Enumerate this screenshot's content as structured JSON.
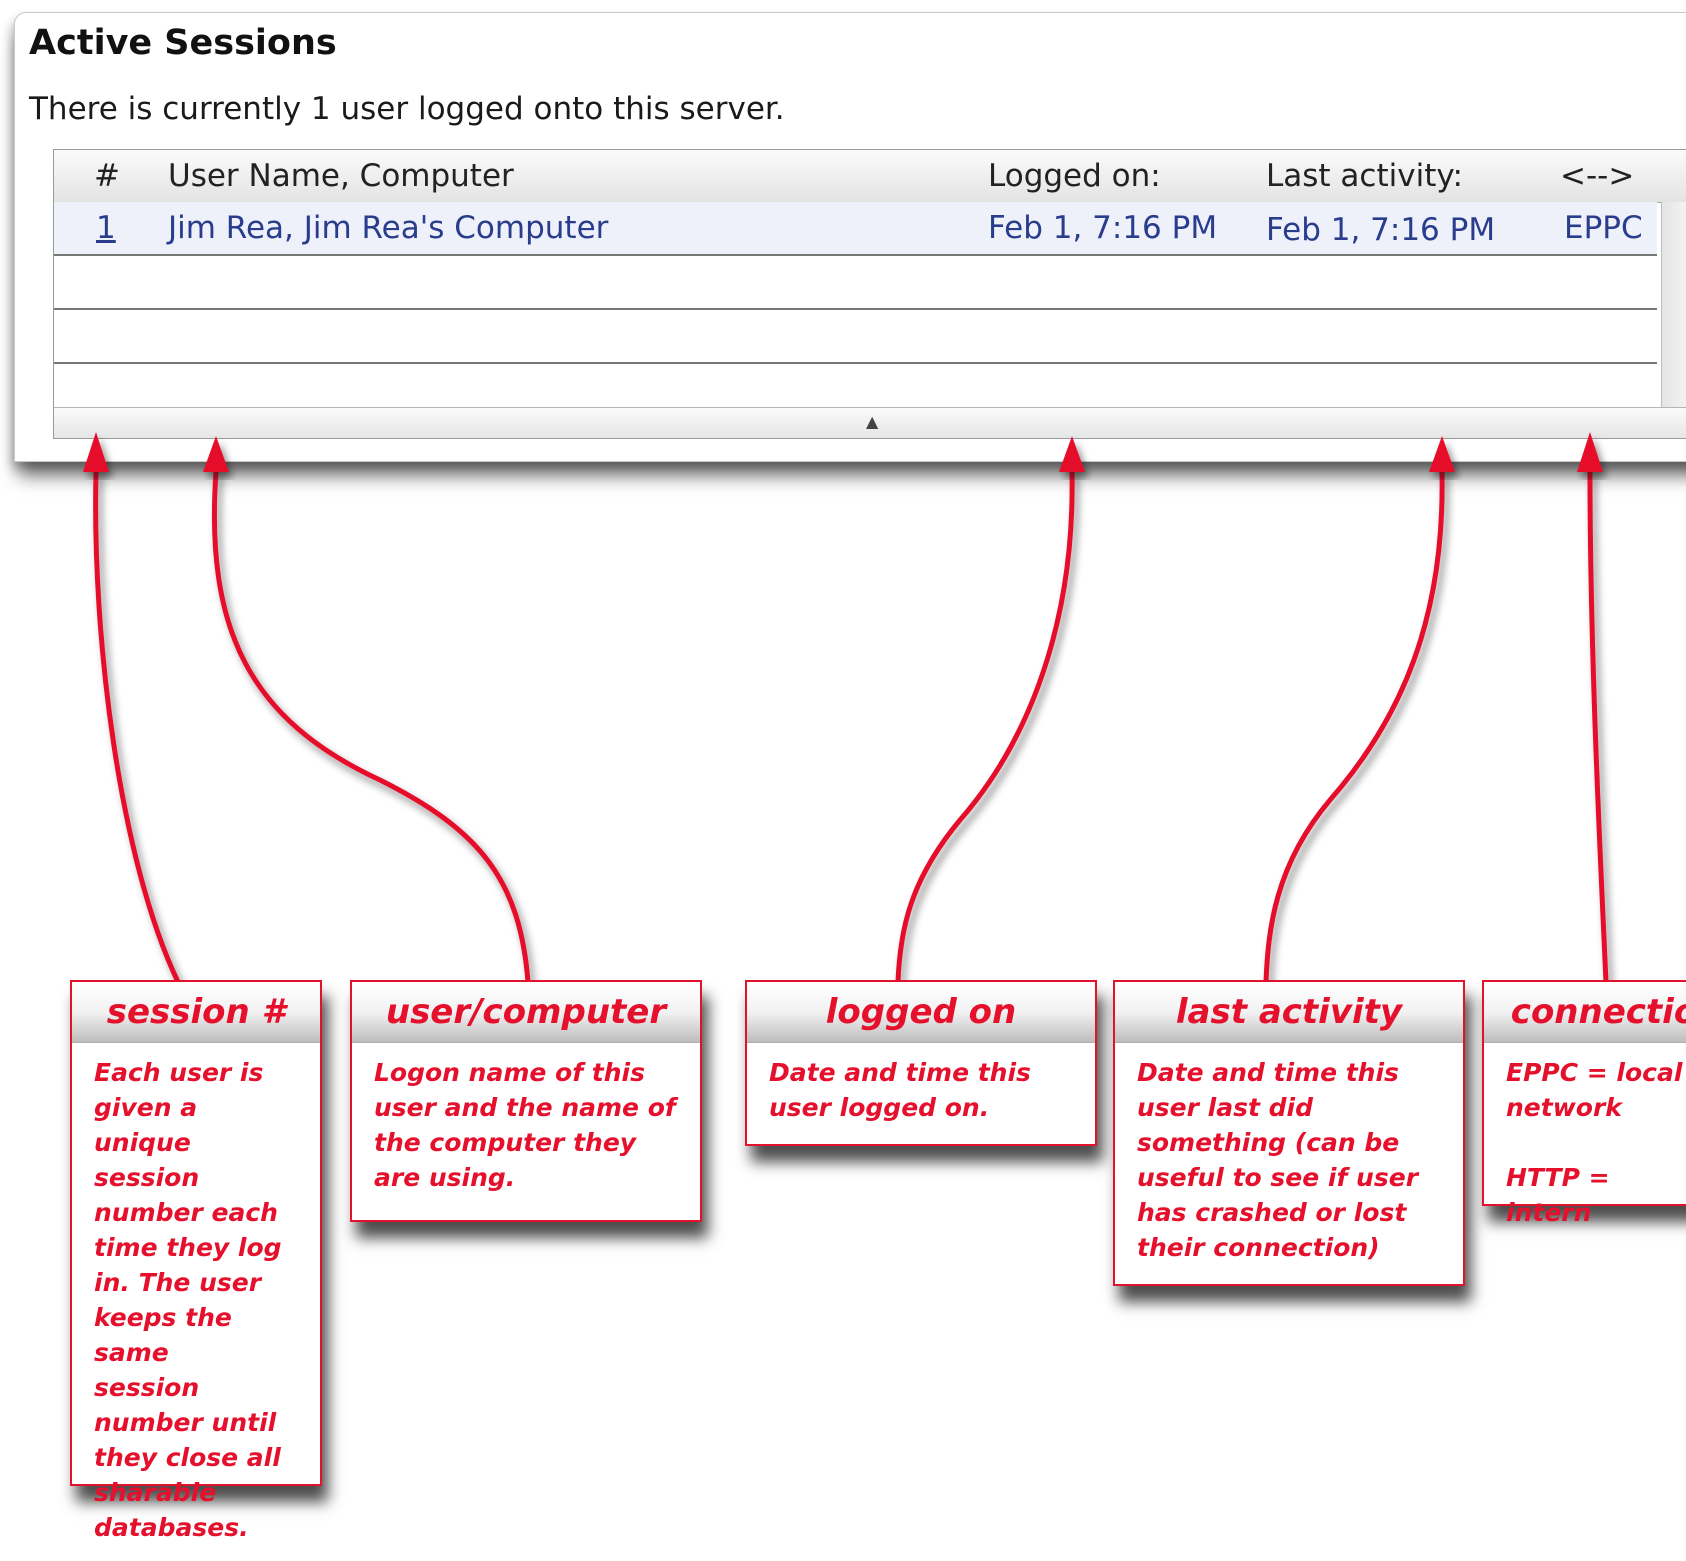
{
  "dialog": {
    "title": "Active Sessions",
    "subtitle": "There is currently 1 user logged onto this server."
  },
  "table": {
    "headers": {
      "num": "#",
      "user": "User Name, Computer",
      "logged_on": "Logged on:",
      "last_activity": "Last activity:",
      "connection": "<-->"
    },
    "rows": [
      {
        "num": "1",
        "user": "Jim Rea, Jim Rea's Computer",
        "logged_on": "Feb 1, 7:16 PM",
        "last_activity": "Feb 1, 7:16 PM",
        "connection": "EPPC"
      }
    ],
    "empty_rows": 3
  },
  "callouts": {
    "session": {
      "title": "session #",
      "text": "Each user is\ngiven a unique\nsession\nnumber each\ntime they log\nin. The user\nkeeps the same\nsession\nnumber until\nthey close all\nsharable\ndatabases."
    },
    "user": {
      "title": "user/computer",
      "text": "Logon name of this\nuser and the name of\nthe computer they\nare using."
    },
    "logged_on": {
      "title": "logged on",
      "text": "Date and time this\nuser logged on."
    },
    "last_activity": {
      "title": "last activity",
      "text": "Date and time this\nuser last did\nsomething (can be\nuseful to see if user\nhas crashed or lost\ntheir connection)"
    },
    "connection": {
      "title": "connectio",
      "text": "EPPC = local\nnetwork\n\nHTTP = intern"
    }
  },
  "colors": {
    "annotation": "#e5102c",
    "row_text": "#2a3d8c"
  }
}
